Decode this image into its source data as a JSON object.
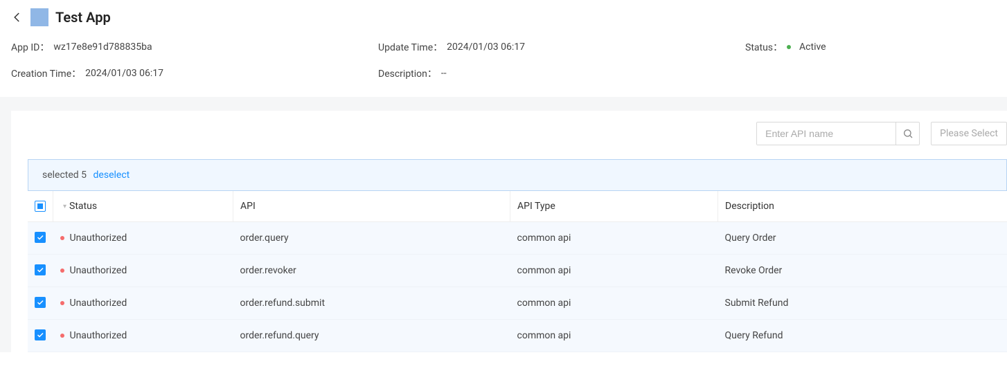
{
  "header": {
    "title": "Test App",
    "app_id_label": "App ID：",
    "app_id_value": "wz17e8e91d788835ba",
    "update_time_label": "Update Time：",
    "update_time_value": "2024/01/03 06:17",
    "status_label": "Status：",
    "status_value": "Active",
    "creation_time_label": "Creation Time：",
    "creation_time_value": "2024/01/03 06:17",
    "description_label": "Description：",
    "description_value": "--"
  },
  "filters": {
    "search_placeholder": "Enter API name",
    "select_placeholder": "Please Select"
  },
  "selection_bar": {
    "text": "selected 5",
    "deselect": "deselect"
  },
  "table": {
    "headers": {
      "status": "Status",
      "api": "API",
      "api_type": "API Type",
      "description": "Description"
    },
    "rows": [
      {
        "checked": true,
        "status": "Unauthorized",
        "api": "order.query",
        "type": "common api",
        "desc": "Query Order"
      },
      {
        "checked": true,
        "status": "Unauthorized",
        "api": "order.revoker",
        "type": "common api",
        "desc": "Revoke Order"
      },
      {
        "checked": true,
        "status": "Unauthorized",
        "api": "order.refund.submit",
        "type": "common api",
        "desc": "Submit Refund"
      },
      {
        "checked": true,
        "status": "Unauthorized",
        "api": "order.refund.query",
        "type": "common api",
        "desc": "Query Refund"
      }
    ]
  }
}
